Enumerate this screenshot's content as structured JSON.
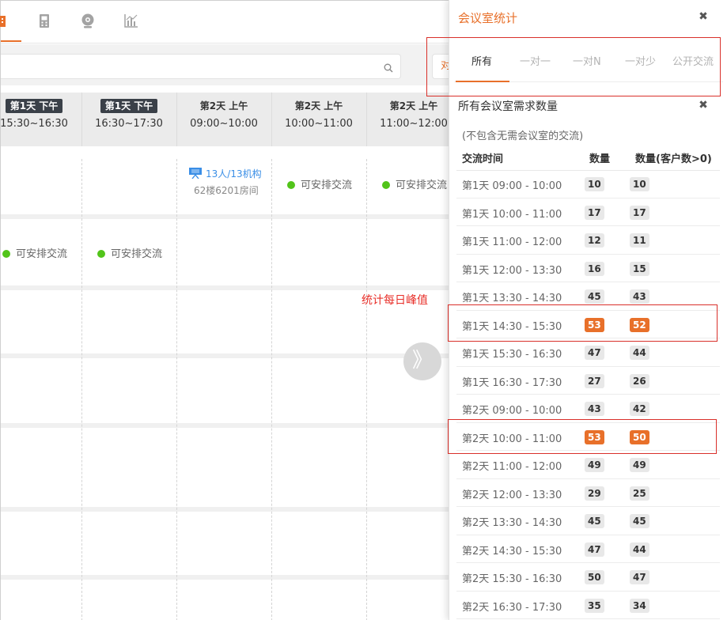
{
  "nav": {
    "icons": [
      "building-icon",
      "phone-icon",
      "webcam-icon",
      "chart-icon"
    ]
  },
  "toolbar": {
    "peek_button_label": "对"
  },
  "schedule": {
    "columns": [
      {
        "day": "第1天 下午",
        "time": "15:30~16:30",
        "highlight": true
      },
      {
        "day": "第1天 下午",
        "time": "16:30~17:30",
        "highlight": true
      },
      {
        "day": "第2天 上午",
        "time": "09:00~10:00",
        "highlight": false
      },
      {
        "day": "第2天 上午",
        "time": "10:00~11:00",
        "highlight": false
      },
      {
        "day": "第2天 上午",
        "time": "11:00~12:00",
        "highlight": false
      }
    ],
    "booking": {
      "people": "13人/13机构",
      "room": "62楼6201房间"
    },
    "available_label": "可安排交流"
  },
  "annotation": {
    "peak_label": "统计每日峰值"
  },
  "expand_glyph": "》",
  "panel": {
    "title": "会议室统计",
    "close_glyph": "✖",
    "tabs": [
      "所有",
      "一对一",
      "一对N",
      "一对少",
      "公开交流"
    ],
    "active_tab": "所有",
    "section_title": "所有会议室需求数量",
    "section_close_glyph": "✖",
    "note": "(不包含无需会议室的交流)",
    "table_headers": {
      "time": "交流时间",
      "count": "数量",
      "count_clients": "数量(客户数>0)"
    },
    "rows": [
      {
        "time": "第1天 09:00 - 10:00",
        "count": "10",
        "count_clients": "10",
        "peak": false
      },
      {
        "time": "第1天 10:00 - 11:00",
        "count": "17",
        "count_clients": "17",
        "peak": false
      },
      {
        "time": "第1天 11:00 - 12:00",
        "count": "12",
        "count_clients": "11",
        "peak": false
      },
      {
        "time": "第1天 12:00 - 13:30",
        "count": "16",
        "count_clients": "15",
        "peak": false
      },
      {
        "time": "第1天 13:30 - 14:30",
        "count": "45",
        "count_clients": "43",
        "peak": false
      },
      {
        "time": "第1天 14:30 - 15:30",
        "count": "53",
        "count_clients": "52",
        "peak": true
      },
      {
        "time": "第1天 15:30 - 16:30",
        "count": "47",
        "count_clients": "44",
        "peak": false
      },
      {
        "time": "第1天 16:30 - 17:30",
        "count": "27",
        "count_clients": "26",
        "peak": false
      },
      {
        "time": "第2天 09:00 - 10:00",
        "count": "43",
        "count_clients": "42",
        "peak": false
      },
      {
        "time": "第2天 10:00 - 11:00",
        "count": "53",
        "count_clients": "50",
        "peak": true
      },
      {
        "time": "第2天 11:00 - 12:00",
        "count": "49",
        "count_clients": "49",
        "peak": false
      },
      {
        "time": "第2天 12:00 - 13:30",
        "count": "29",
        "count_clients": "25",
        "peak": false
      },
      {
        "time": "第2天 13:30 - 14:30",
        "count": "45",
        "count_clients": "45",
        "peak": false
      },
      {
        "time": "第2天 14:30 - 15:30",
        "count": "47",
        "count_clients": "44",
        "peak": false
      },
      {
        "time": "第2天 15:30 - 16:30",
        "count": "50",
        "count_clients": "47",
        "peak": false
      },
      {
        "time": "第2天 16:30 - 17:30",
        "count": "35",
        "count_clients": "34",
        "peak": false
      }
    ]
  },
  "colors": {
    "accent": "#e8702a",
    "available": "#52c41a",
    "link": "#3a8ee6",
    "annotation": "#d9302a"
  }
}
